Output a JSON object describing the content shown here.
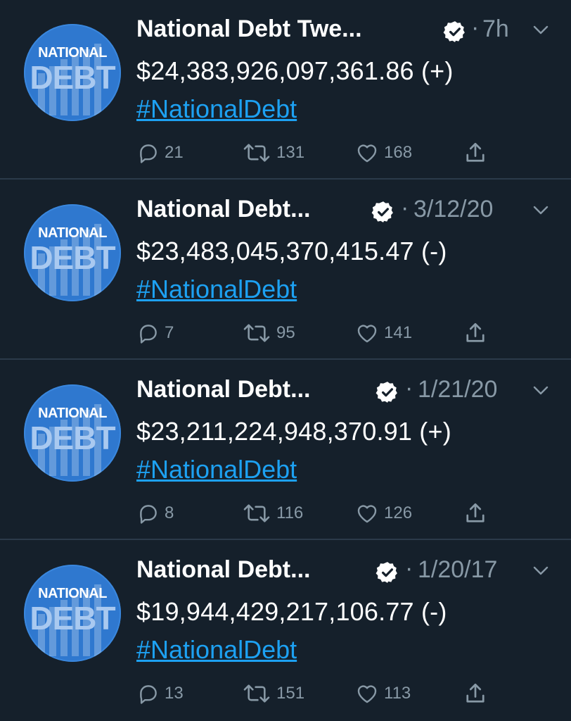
{
  "colors": {
    "background": "#15202b",
    "divider": "#2b3a4a",
    "secondary_text": "#8899a6",
    "link": "#1da1f2",
    "avatar_bg": "#2f78cf"
  },
  "avatar": {
    "line1": "NATIONAL",
    "line2": "DEBT"
  },
  "tweets": [
    {
      "name": "National Debt Twe...",
      "dot": "·",
      "time": "7h",
      "amount": "$24,383,926,097,361.86 (+)",
      "hashtag": "#NationalDebt",
      "replies": "21",
      "retweets": "131",
      "likes": "168"
    },
    {
      "name": "National Debt...",
      "dot": "·",
      "time": "3/12/20",
      "amount": "$23,483,045,370,415.47 (-)",
      "hashtag": "#NationalDebt",
      "replies": "7",
      "retweets": "95",
      "likes": "141"
    },
    {
      "name": "National Debt...",
      "dot": "·",
      "time": "1/21/20",
      "amount": "$23,211,224,948,370.91 (+)",
      "hashtag": "#NationalDebt",
      "replies": "8",
      "retweets": "116",
      "likes": "126"
    },
    {
      "name": "National Debt...",
      "dot": "·",
      "time": "1/20/17",
      "amount": "$19,944,429,217,106.77 (-)",
      "hashtag": "#NationalDebt",
      "replies": "13",
      "retweets": "151",
      "likes": "113"
    }
  ]
}
